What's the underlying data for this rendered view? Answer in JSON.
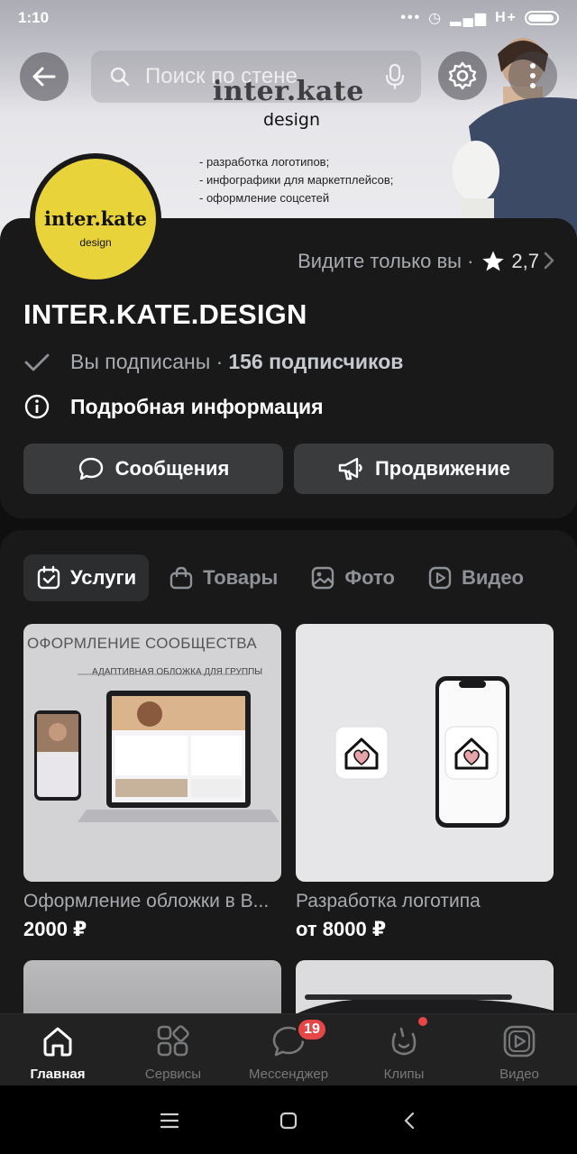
{
  "status_bar": {
    "time": "1:10",
    "network": "H+"
  },
  "header": {
    "search_placeholder": "Поиск по стене"
  },
  "cover": {
    "brand": "inter.kate",
    "brand_sub": "design",
    "list": [
      "- разработка логотипов;",
      "- инфографики для маркетплейсов;",
      "- оформление соцсетей"
    ]
  },
  "avatar": {
    "brand": "inter.kate",
    "brand_sub": "design",
    "bg_color": "#e8d33b"
  },
  "profile": {
    "visibility": "Видите только вы ·",
    "rating": "2,7",
    "title": "INTER.KATE.DESIGN",
    "subscribed": "Вы подписаны ·",
    "subscribers": "156 подписчиков",
    "details": "Подробная информация",
    "messages_label": "Сообщения",
    "promo_label": "Продвижение"
  },
  "tabs": [
    {
      "label": "Услуги",
      "active": true
    },
    {
      "label": "Товары",
      "active": false
    },
    {
      "label": "Фото",
      "active": false
    },
    {
      "label": "Видео",
      "active": false
    }
  ],
  "services": [
    {
      "image_caption": "ОФОРМЛЕНИЕ СООБЩЕСТВА",
      "image_sub": "АДАПТИВНАЯ ОБЛОЖКА ДЛЯ ГРУППЫ",
      "title": "Оформление обложки в В...",
      "price": "2000 ₽"
    },
    {
      "title": "Разработка логотипа",
      "price": "от 8000 ₽"
    }
  ],
  "tabbar": {
    "items": [
      {
        "label": "Главная",
        "icon": "home-icon",
        "active": true
      },
      {
        "label": "Сервисы",
        "icon": "services-icon",
        "active": false
      },
      {
        "label": "Мессенджер",
        "icon": "messenger-icon",
        "active": false
      },
      {
        "label": "Клипы",
        "icon": "clips-icon",
        "active": false
      },
      {
        "label": "Видео",
        "icon": "video-icon",
        "active": false
      }
    ],
    "messenger_badge": "19"
  },
  "colors": {
    "accent_yellow": "#e8d33b",
    "badge_red": "#e64646",
    "background": "#19191a"
  }
}
